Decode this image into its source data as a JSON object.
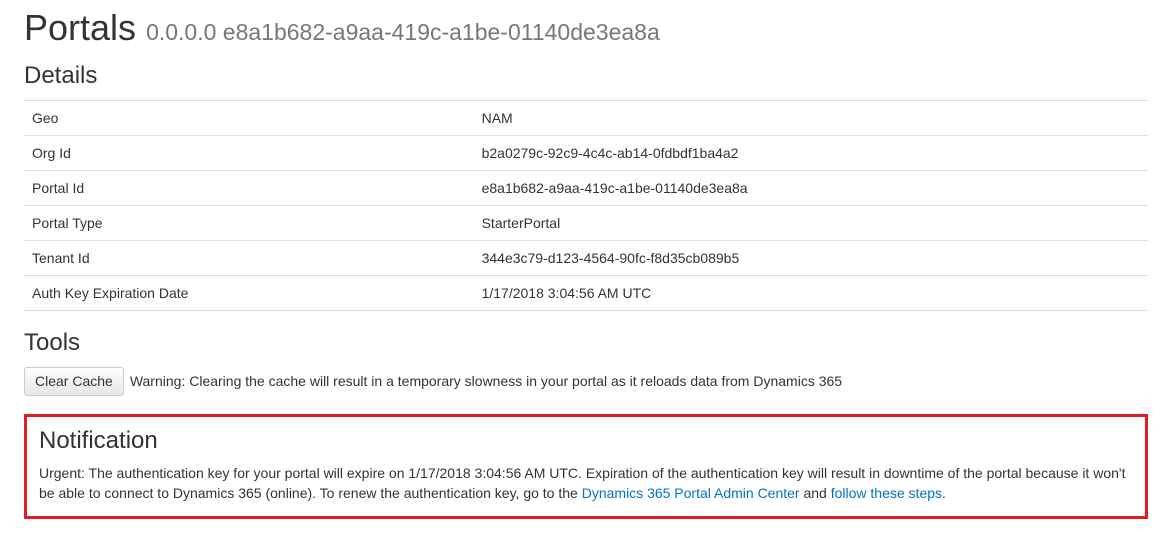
{
  "header": {
    "title": "Portals",
    "subtitle": "0.0.0.0 e8a1b682-a9aa-419c-a1be-01140de3ea8a"
  },
  "details": {
    "heading": "Details",
    "rows": [
      {
        "label": "Geo",
        "value": "NAM"
      },
      {
        "label": "Org Id",
        "value": "b2a0279c-92c9-4c4c-ab14-0fdbdf1ba4a2"
      },
      {
        "label": "Portal Id",
        "value": "e8a1b682-a9aa-419c-a1be-01140de3ea8a"
      },
      {
        "label": "Portal Type",
        "value": "StarterPortal"
      },
      {
        "label": "Tenant Id",
        "value": "344e3c79-d123-4564-90fc-f8d35cb089b5"
      },
      {
        "label": "Auth Key Expiration Date",
        "value": "1/17/2018 3:04:56 AM UTC"
      }
    ]
  },
  "tools": {
    "heading": "Tools",
    "clear_cache_label": "Clear Cache",
    "warning_text": "Warning: Clearing the cache will result in a temporary slowness in your portal as it reloads data from Dynamics 365"
  },
  "notification": {
    "heading": "Notification",
    "text_before_link1": "Urgent: The authentication key for your portal will expire on 1/17/2018 3:04:56 AM UTC. Expiration of the authentication key will result in downtime of the portal because it won't be able to connect to Dynamics 365 (online). To renew the authentication key, go to the ",
    "link1_text": "Dynamics 365 Portal Admin Center",
    "text_between": " and ",
    "link2_text": "follow these steps",
    "text_after": "."
  }
}
